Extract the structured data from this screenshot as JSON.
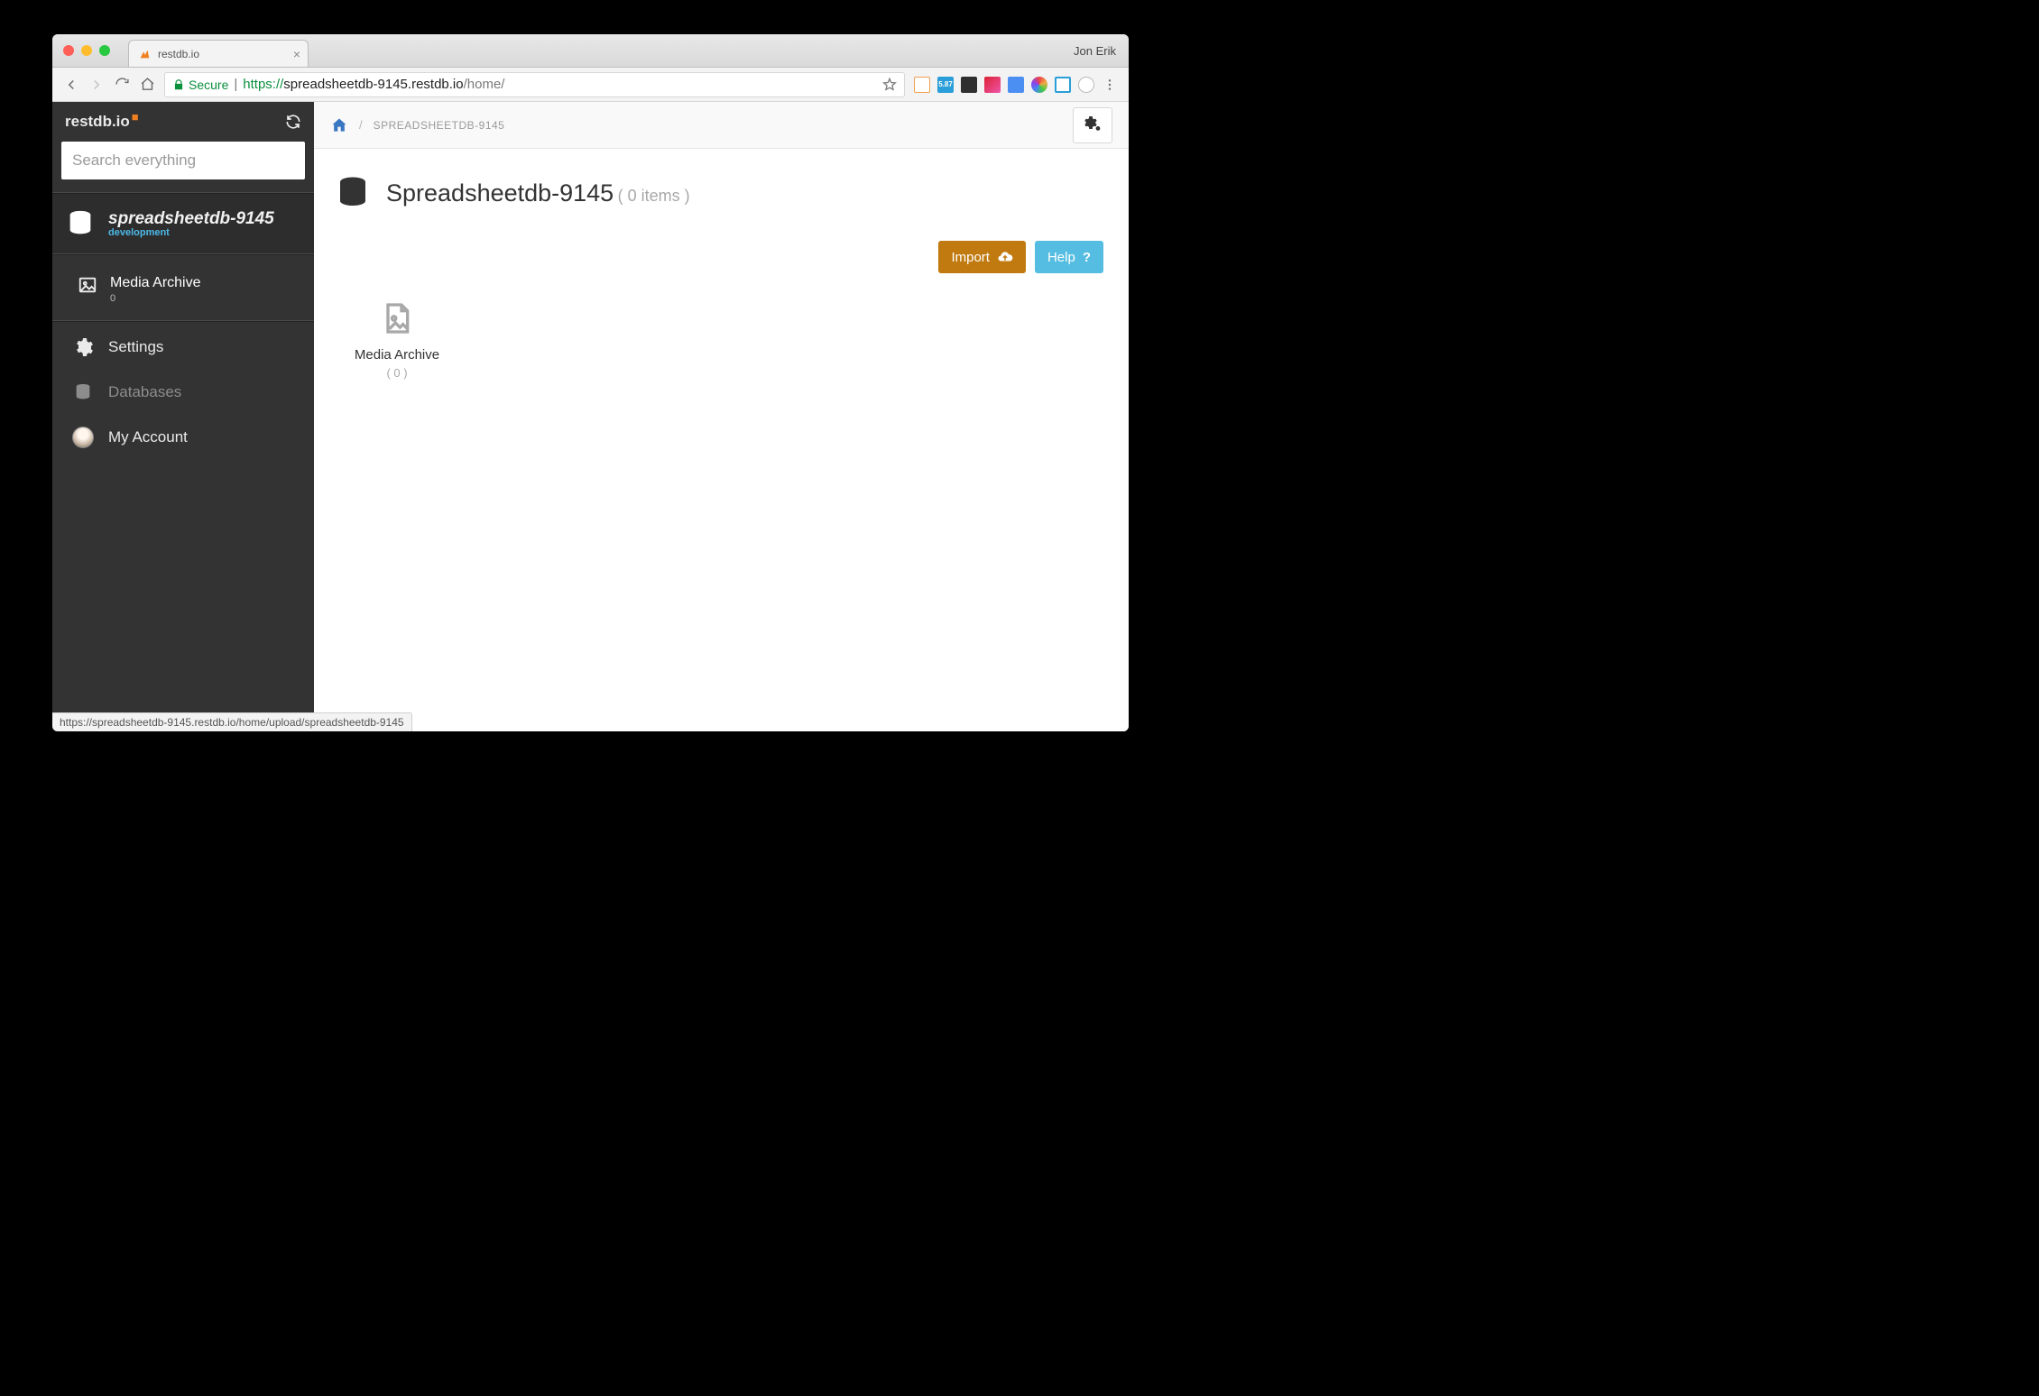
{
  "browser": {
    "tab_title": "restdb.io",
    "user_name": "Jon Erik",
    "secure_label": "Secure",
    "url_scheme": "https://",
    "url_host": "spreadsheetdb-9145.restdb.io",
    "url_path": "/home/",
    "status_url": "https://spreadsheetdb-9145.restdb.io/home/upload/spreadsheetdb-9145"
  },
  "sidebar": {
    "logo_text": "restdb.io",
    "search_placeholder": "Search everything",
    "db_name": "spreadsheetdb-9145",
    "db_env": "development",
    "collections": [
      {
        "label": "Media Archive",
        "count": "0"
      }
    ],
    "nav": {
      "settings": "Settings",
      "databases": "Databases",
      "account": "My Account"
    }
  },
  "main": {
    "breadcrumb": "SPREADSHEETDB-9145",
    "title": "Spreadsheetdb-9145",
    "items_text": "( 0 items )",
    "import_label": "Import",
    "help_label": "Help",
    "tiles": [
      {
        "label": "Media Archive",
        "count": "( 0 )"
      }
    ]
  }
}
